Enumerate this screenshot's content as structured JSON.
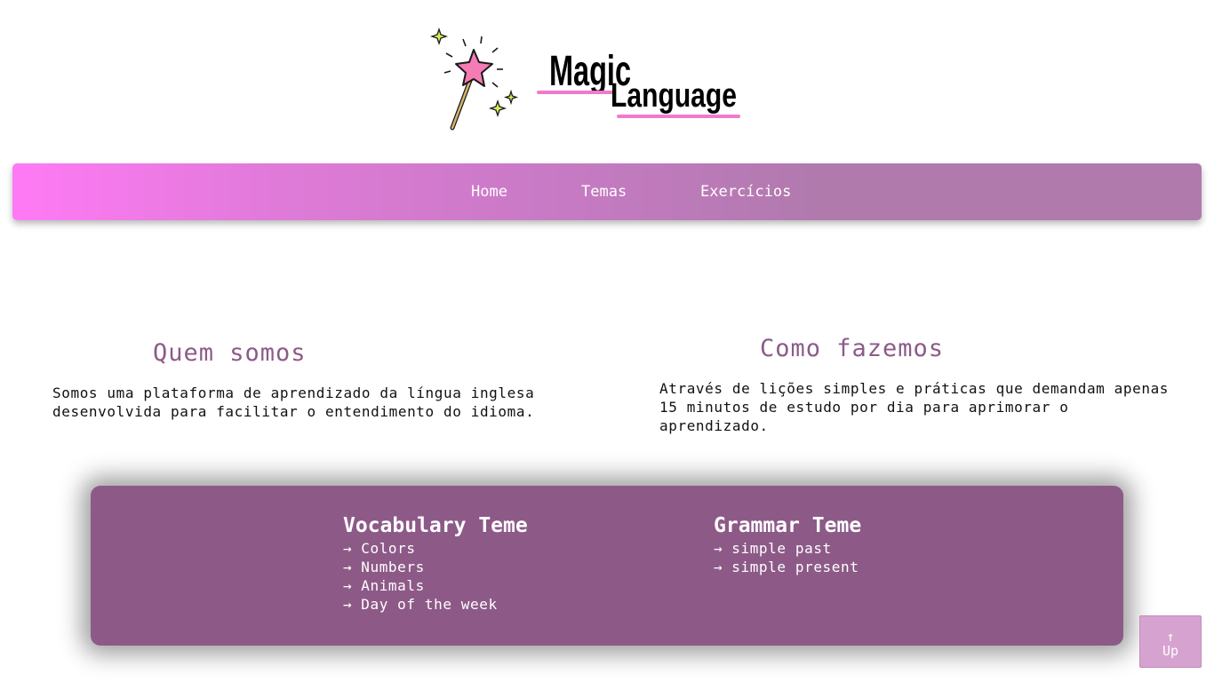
{
  "logo": {
    "word_top": "Magic",
    "word_bottom": "Language",
    "accent_color": "#f07acb",
    "star_color": "#f57bb5",
    "sparkle_color": "#d7f05a"
  },
  "nav": {
    "items": [
      {
        "label": "Home"
      },
      {
        "label": "Temas"
      },
      {
        "label": "Exercícios"
      }
    ]
  },
  "about": {
    "title": "Quem somos",
    "text": "Somos uma plataforma de aprendizado da língua inglesa desenvolvida para facilitar o entendimento do idioma."
  },
  "method": {
    "title": "Como fazemos",
    "text": "Através de lições simples e práticas que demandam apenas 15 minutos de estudo por dia para aprimorar o aprendizado."
  },
  "themes": {
    "arrow": "→",
    "vocabulary": {
      "title": "Vocabulary Teme",
      "items": [
        "Colors",
        "Numbers",
        "Animals",
        "Day of the week"
      ]
    },
    "grammar": {
      "title": "Grammar Teme",
      "items": [
        "simple past",
        "simple present"
      ]
    }
  },
  "up_button": {
    "arrow": "↑",
    "label": "Up"
  },
  "colors": {
    "panel": "#8d5a88",
    "heading": "#8d5a88",
    "nav_start": "#ff7af5",
    "nav_end": "#b07aad"
  }
}
